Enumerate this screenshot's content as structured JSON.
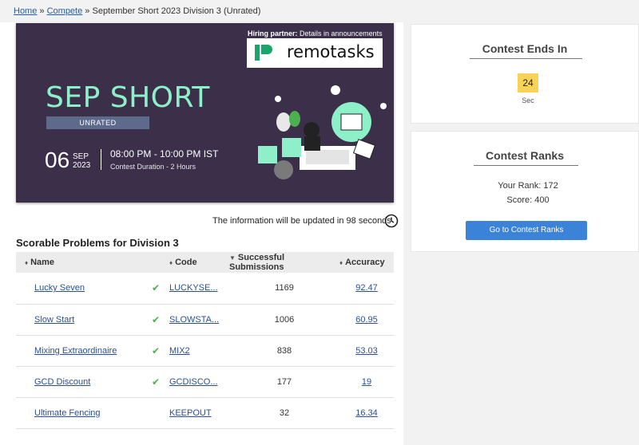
{
  "breadcrumb": {
    "home": "Home",
    "sep1": "»",
    "compete": "Compete",
    "sep2": "»",
    "current": "September Short 2023 Division 3 (Unrated)"
  },
  "banner": {
    "hiring_label": "Hiring partner:",
    "hiring_detail": "Details in announcements",
    "sponsor": "remotasks",
    "title": "SEP SHORT",
    "badge": "UNRATED",
    "day": "06",
    "month": "SEP",
    "year": "2023",
    "time": "08:00 PM - 10:00 PM IST",
    "duration": "Contest Duration - 2 Hours"
  },
  "update_notice": "The information will be updated in 98 seconds",
  "problems": {
    "title": "Scorable Problems for Division 3",
    "columns": {
      "name": "Name",
      "code": "Code",
      "submissions": "Successful Submissions",
      "accuracy": "Accuracy"
    },
    "rows": [
      {
        "name": "Lucky Seven",
        "solved": true,
        "code": "LUCKYSE...",
        "submissions": "1169",
        "accuracy": "92.47"
      },
      {
        "name": "Slow Start",
        "solved": true,
        "code": "SLOWSTA...",
        "submissions": "1006",
        "accuracy": "60.95"
      },
      {
        "name": "Mixing Extraordinaire",
        "solved": true,
        "code": "MIX2",
        "submissions": "838",
        "accuracy": "53.03"
      },
      {
        "name": "GCD Discount",
        "solved": true,
        "code": "GCDISCO...",
        "submissions": "177",
        "accuracy": "19"
      },
      {
        "name": "Ultimate Fencing",
        "solved": false,
        "code": "KEEPOUT",
        "submissions": "32",
        "accuracy": "16.34"
      }
    ]
  },
  "timer": {
    "title": "Contest Ends In",
    "value": "24",
    "unit": "Sec"
  },
  "ranks": {
    "title": "Contest Ranks",
    "your_rank": "Your Rank: 172",
    "score": "Score: 400",
    "button": "Go to Contest Ranks"
  },
  "colors": {
    "accent": "#3b83d8",
    "banner_bg": "#3b2f4a",
    "title_green": "#8ef0c8",
    "timer": "#f7d358",
    "check": "#4caf50"
  }
}
